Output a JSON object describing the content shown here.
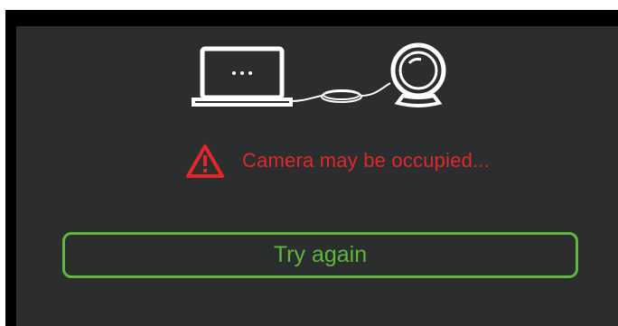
{
  "status": {
    "message": "Camera may be occupied..."
  },
  "actions": {
    "retry_label": "Try again"
  },
  "icons": {
    "laptop": "laptop-icon",
    "webcam": "webcam-icon",
    "cable": "cable-icon",
    "warning": "warning-icon"
  },
  "colors": {
    "panel_background": "#2b2d2f",
    "error": "#e0282a",
    "accent": "#5fb83c",
    "icon_stroke": "#ffffff"
  }
}
